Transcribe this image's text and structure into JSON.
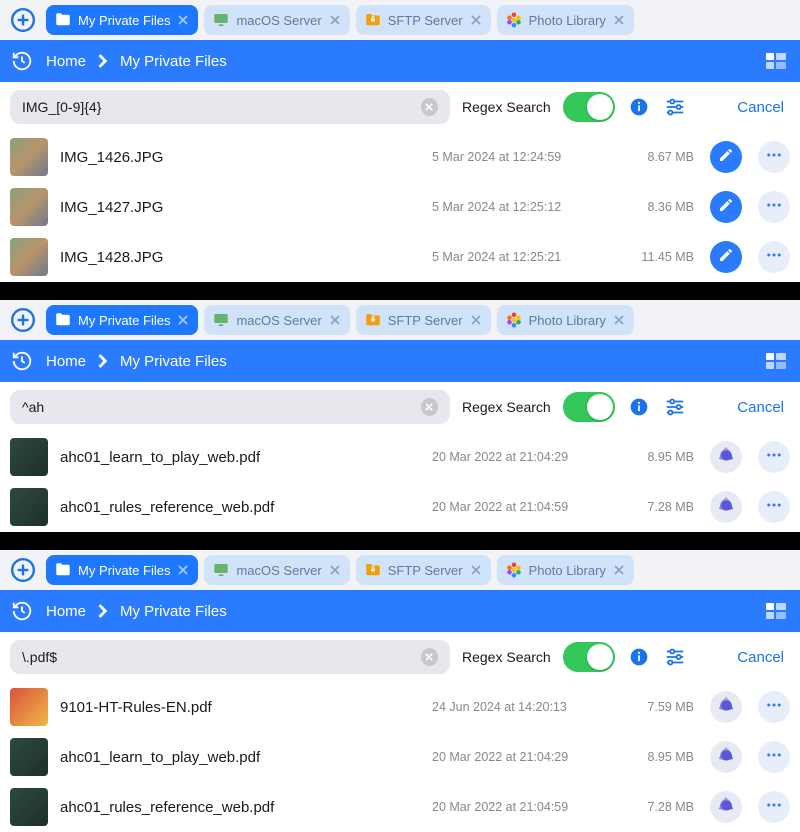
{
  "common": {
    "tabs": [
      {
        "label": "My Private Files",
        "icon": "folder-icon",
        "active": true
      },
      {
        "label": "macOS Server",
        "icon": "monitor-icon",
        "active": false
      },
      {
        "label": "SFTP Server",
        "icon": "lock-folder-icon",
        "active": false
      },
      {
        "label": "Photo Library",
        "icon": "flower-icon",
        "active": false
      }
    ],
    "breadcrumb": {
      "home": "Home",
      "current": "My Private Files"
    },
    "search": {
      "regex_label": "Regex Search",
      "cancel_label": "Cancel",
      "toggle_on": true
    }
  },
  "panels": [
    {
      "search_value": "IMG_[0-9]{4}",
      "files": [
        {
          "name": "IMG_1426.JPG",
          "date": "5 Mar 2024 at 12:24:59",
          "size": "8.67 MB",
          "thumb": "photo",
          "action_icon": "pencil-icon"
        },
        {
          "name": "IMG_1427.JPG",
          "date": "5 Mar 2024 at 12:25:12",
          "size": "8.36 MB",
          "thumb": "photo",
          "action_icon": "pencil-icon"
        },
        {
          "name": "IMG_1428.JPG",
          "date": "5 Mar 2024 at 12:25:21",
          "size": "11.45 MB",
          "thumb": "photo",
          "action_icon": "pencil-icon"
        }
      ]
    },
    {
      "search_value": "^ah",
      "files": [
        {
          "name": "ahc01_learn_to_play_web.pdf",
          "date": "20 Mar 2022 at 21:04:29",
          "size": "8.95 MB",
          "thumb": "pdf",
          "action_icon": "pdf-app-icon"
        },
        {
          "name": "ahc01_rules_reference_web.pdf",
          "date": "20 Mar 2022 at 21:04:59",
          "size": "7.28 MB",
          "thumb": "pdf",
          "action_icon": "pdf-app-icon"
        }
      ]
    },
    {
      "search_value": "\\.pdf$",
      "files": [
        {
          "name": "9101-HT-Rules-EN.pdf",
          "date": "24 Jun 2024 at 14:20:13",
          "size": "7.59 MB",
          "thumb": "heat",
          "action_icon": "pdf-app-icon"
        },
        {
          "name": "ahc01_learn_to_play_web.pdf",
          "date": "20 Mar 2022 at 21:04:29",
          "size": "8.95 MB",
          "thumb": "pdf",
          "action_icon": "pdf-app-icon"
        },
        {
          "name": "ahc01_rules_reference_web.pdf",
          "date": "20 Mar 2022 at 21:04:59",
          "size": "7.28 MB",
          "thumb": "pdf",
          "action_icon": "pdf-app-icon"
        }
      ]
    }
  ]
}
